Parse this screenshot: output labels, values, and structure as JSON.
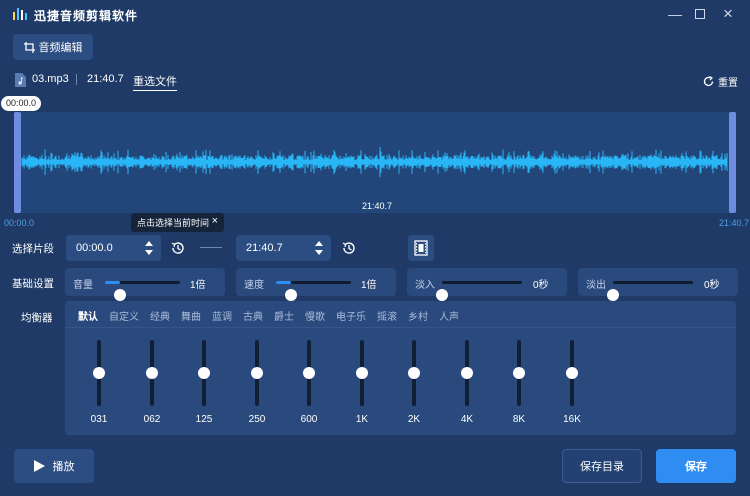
{
  "app": {
    "title": "迅捷音频剪辑软件"
  },
  "window": {
    "minimize_icon": "minimize-icon",
    "maximize_icon": "maximize-icon",
    "close_icon": "close-icon"
  },
  "toolbar": {
    "audio_edit_label": "音频编辑"
  },
  "file": {
    "name": "03.mp3",
    "duration": "21:40.7",
    "reselect_label": "重选文件",
    "reset_label": "重置"
  },
  "waveform": {
    "start_bubble": "00:00.0",
    "center_time": "21:40.7",
    "start_label": "00:00.0",
    "end_label": "21:40.7",
    "tooltip": "点击选择当前时间",
    "color": "#29b6f6"
  },
  "selection": {
    "label": "选择片段",
    "start_value": "00:00.0",
    "end_value": "21:40.7"
  },
  "basic": {
    "label": "基础设置",
    "volume": {
      "label": "音量",
      "value_label": "1倍",
      "level": 0.2
    },
    "speed": {
      "label": "速度",
      "value_label": "1倍",
      "level": 0.2
    },
    "fade_in": {
      "label": "淡入",
      "value_label": "0秒",
      "level": 0.0
    },
    "fade_out": {
      "label": "淡出",
      "value_label": "0秒",
      "level": 0.0
    }
  },
  "equalizer": {
    "label": "均衡器",
    "tabs": [
      "默认",
      "自定义",
      "经典",
      "舞曲",
      "蓝调",
      "古典",
      "爵士",
      "慢歌",
      "电子乐",
      "摇滚",
      "乡村",
      "人声"
    ],
    "active_tab": 0,
    "bands": [
      "031",
      "062",
      "125",
      "250",
      "600",
      "1K",
      "2K",
      "4K",
      "8K",
      "16K"
    ]
  },
  "actions": {
    "play_label": "播放",
    "save_dir_label": "保存目录",
    "save_label": "保存"
  },
  "colors": {
    "accent": "#2f8cf0",
    "background": "#1f3a66",
    "panel": "#2a497c"
  }
}
